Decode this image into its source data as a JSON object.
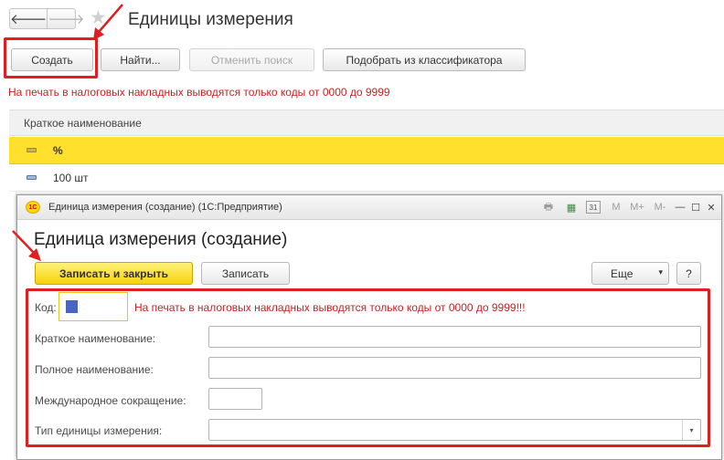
{
  "main_window": {
    "title": "Единицы измерения",
    "nav": {
      "back_icon": "arrow-left-icon",
      "back_glyph": "🡐",
      "forward_icon": "arrow-right-icon",
      "forward_glyph": "🡒",
      "favorite_icon": "star-icon",
      "favorite_glyph": "★"
    },
    "toolbar": {
      "create_label": "Создать",
      "find_label": "Найти...",
      "cancel_search_label": "Отменить поиск",
      "pick_classifier_label": "Подобрать из классификатора"
    },
    "warning_text": "На печать в налоговых накладных выводятся только коды от 0000 до 9999",
    "grid": {
      "column_header": "Краткое наименование",
      "rows": [
        {
          "name": "%",
          "selected": true
        },
        {
          "name": "100 шт",
          "selected": false
        }
      ]
    }
  },
  "dialog": {
    "caption": "Единица измерения (создание)  (1С:Предприятие)",
    "logo_text": "1С",
    "heading": "Единица измерения (создание)",
    "titlebar_icons": [
      {
        "name": "print-icon",
        "glyph": "🖶"
      },
      {
        "name": "calculator-icon",
        "glyph": "▦"
      },
      {
        "name": "calendar-icon",
        "glyph": "31"
      },
      {
        "name": "memory-m-icon",
        "glyph": "M"
      },
      {
        "name": "memory-plus-icon",
        "glyph": "M+"
      },
      {
        "name": "memory-minus-icon",
        "glyph": "M-"
      },
      {
        "name": "minimize-icon",
        "glyph": "—"
      },
      {
        "name": "maximize-icon",
        "glyph": "☐"
      },
      {
        "name": "close-icon",
        "glyph": "✕"
      }
    ],
    "toolbar": {
      "save_close_label": "Записать и закрыть",
      "save_label": "Записать",
      "more_label": "Еще",
      "more_arrow": "▾",
      "help_label": "?"
    },
    "form": {
      "code_label": "Код:",
      "code_value": "",
      "code_warning": "На печать в налоговых накладных выводятся только коды от 0000 до 9999!!!",
      "short_name_label": "Краткое наименование:",
      "short_name_value": "",
      "full_name_label": "Полное наименование:",
      "full_name_value": "",
      "intl_abbr_label": "Международное сокращение:",
      "intl_abbr_value": "",
      "unit_type_label": "Тип единицы измерения:",
      "unit_type_value": "",
      "unit_type_arrow": "▾"
    }
  },
  "colors": {
    "accent_yellow": "#ffe02c",
    "primary_button": "#f6d20a",
    "warning_red": "#cc1f1f",
    "annotation_red": "#e02020"
  }
}
